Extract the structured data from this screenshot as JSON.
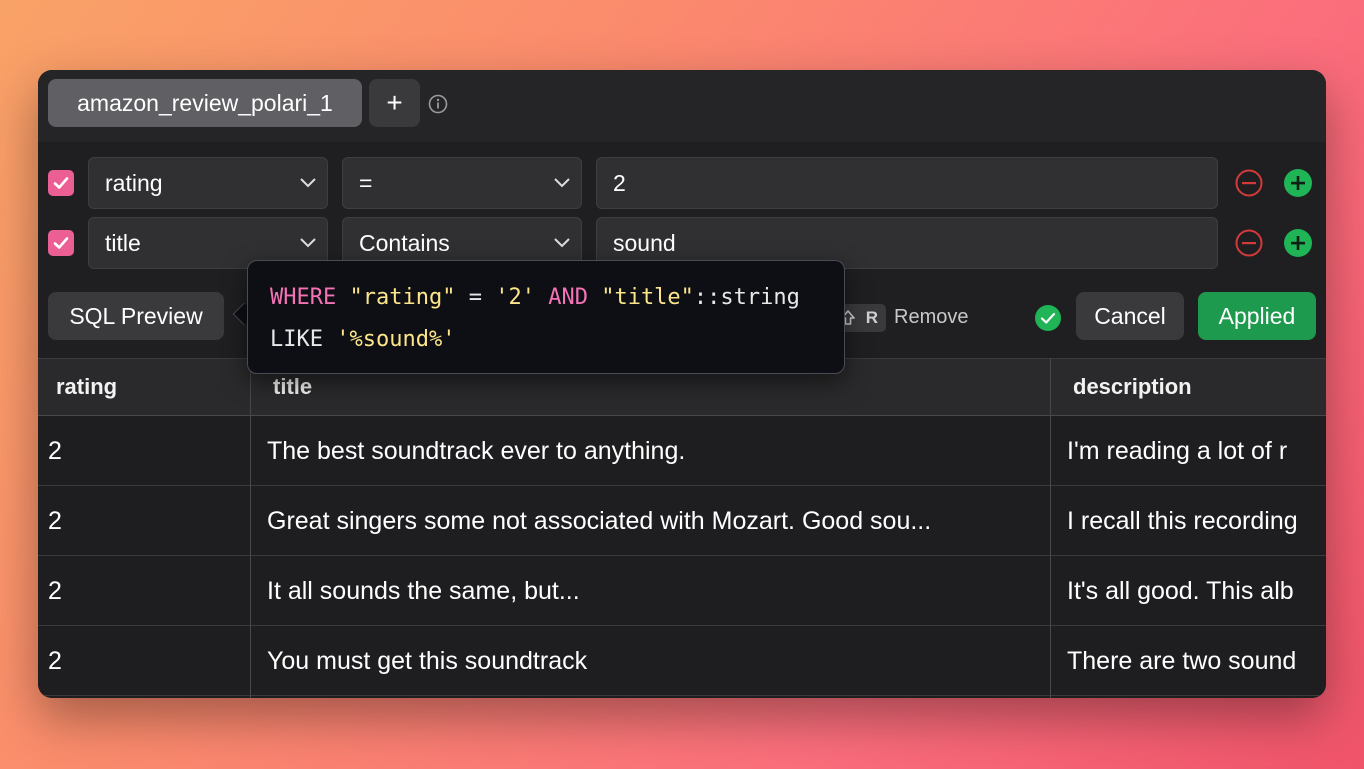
{
  "tabs": {
    "active_label": "amazon_review_polari_1",
    "add_label": "+"
  },
  "filters": [
    {
      "column": "rating",
      "operator": "=",
      "value": "2"
    },
    {
      "column": "title",
      "operator": "Contains",
      "value": "sound"
    }
  ],
  "toolbar": {
    "sql_preview_label": "SQL Preview",
    "shortcut_key": "R",
    "remove_label": "Remove",
    "cancel_label": "Cancel",
    "applied_label": "Applied"
  },
  "sql_tooltip": {
    "kw_where": "WHERE",
    "col_rating": "\"rating\"",
    "op_eq": " = ",
    "val_rating": "'2'",
    "kw_and": "AND",
    "col_title": "\"title\"",
    "cast": "::string LIKE ",
    "val_title": "'%sound%'"
  },
  "table": {
    "columns": [
      "rating",
      "title",
      "description"
    ],
    "rows": [
      {
        "rating": "2",
        "title": "The best soundtrack ever to anything.",
        "description": "I'm reading a lot of r"
      },
      {
        "rating": "2",
        "title": "Great singers some not associated with Mozart. Good sou...",
        "description": "I recall this recording"
      },
      {
        "rating": "2",
        "title": "It all sounds the same, but...",
        "description": "It's all good. This alb"
      },
      {
        "rating": "2",
        "title": "You must get this soundtrack",
        "description": "There are two sound"
      }
    ]
  },
  "colors": {
    "checkbox": "#ec5f94",
    "applied": "#1d9a4d",
    "remove_filter": "#d43a3a",
    "add_filter": "#1fb455"
  },
  "icons": [
    "info-icon",
    "chevron-down-icon",
    "remove-filter-icon",
    "add-filter-icon",
    "check-circle-icon",
    "shift-key-icon"
  ]
}
